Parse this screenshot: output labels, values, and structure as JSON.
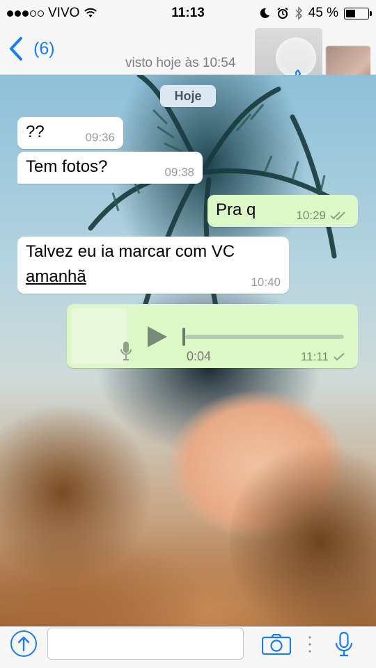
{
  "status_bar": {
    "carrier": "VIVO",
    "time": "11:13",
    "battery": "45 %",
    "battery_level": 0.45
  },
  "header": {
    "back_label": "(6)",
    "last_seen": "visto hoje às 10:54"
  },
  "chat": {
    "date_chip": "Hoje",
    "messages": [
      {
        "direction": "in",
        "text": "??",
        "time": "09:36"
      },
      {
        "direction": "in",
        "text": "Tem fotos?",
        "time": "09:38"
      },
      {
        "direction": "out",
        "text": "Pra q",
        "time": "10:29",
        "status": "read"
      },
      {
        "direction": "in",
        "text": "Talvez eu ia marcar com VC",
        "link": "amanhã",
        "time": "10:40"
      },
      {
        "direction": "out",
        "type": "audio",
        "duration": "0:04",
        "time": "11:11",
        "status": "sent"
      }
    ]
  },
  "input": {
    "placeholder": ""
  },
  "colors": {
    "accent": "#1a7cf5",
    "outgoing_bubble": "#dcf8c6",
    "incoming_bubble": "#ffffff"
  },
  "icons": [
    "wifi-icon",
    "moon-icon",
    "alarm-icon",
    "bluetooth-icon",
    "battery-icon",
    "back-chevron-icon",
    "phone-icon",
    "read-ticks-icon",
    "play-icon",
    "mic-icon",
    "share-icon",
    "camera-icon"
  ]
}
